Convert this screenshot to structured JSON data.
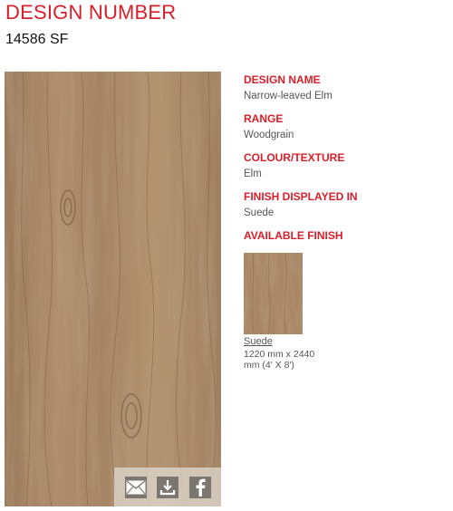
{
  "header": {
    "title": "DESIGN NUMBER",
    "design_number": "14586 SF"
  },
  "details": {
    "design_name_label": "DESIGN NAME",
    "design_name": "Narrow-leaved Elm",
    "range_label": "RANGE",
    "range": "Woodgrain",
    "colour_label": "COLOUR/TEXTURE",
    "colour": "Elm",
    "finish_displayed_label": "FINISH DISPLAYED IN",
    "finish_displayed": "Suede",
    "available_finish_label": "AVAILABLE FINISH"
  },
  "available_finishes": [
    {
      "name": "Suede",
      "dimensions_line1": "1220 mm x 2440",
      "dimensions_line2": "mm (4' X 8')"
    }
  ],
  "actions": {
    "email_icon": "envelope-icon",
    "download_icon": "download-icon",
    "share_icon": "facebook-icon"
  },
  "colors": {
    "accent": "#d71f2a",
    "wood_base": "#a68463",
    "wood_light": "#c2a283",
    "wood_dark": "#7d5f43"
  }
}
